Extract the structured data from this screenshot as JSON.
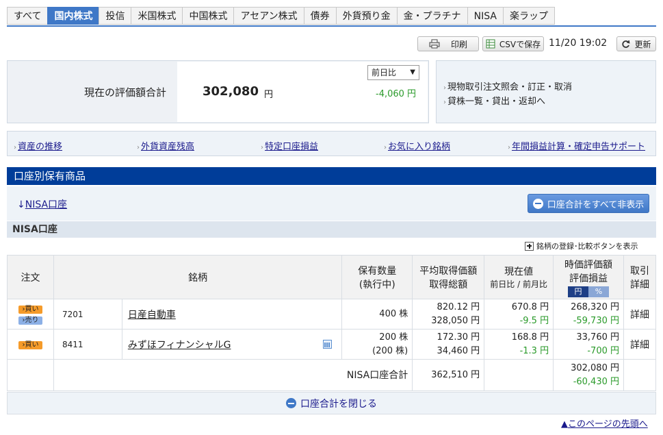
{
  "tabs": [
    {
      "label": "すべて",
      "active": false
    },
    {
      "label": "国内株式",
      "active": true
    },
    {
      "label": "投信",
      "active": false
    },
    {
      "label": "米国株式",
      "active": false
    },
    {
      "label": "中国株式",
      "active": false
    },
    {
      "label": "アセアン株式",
      "active": false
    },
    {
      "label": "債券",
      "active": false
    },
    {
      "label": "外貨預り金",
      "active": false
    },
    {
      "label": "金・プラチナ",
      "active": false
    },
    {
      "label": "NISA",
      "active": false
    },
    {
      "label": "楽ラップ",
      "active": false
    }
  ],
  "toolbar": {
    "print_label": "印刷",
    "csv_label": "CSVで保存",
    "timestamp": "11/20 19:02",
    "refresh_label": "更新"
  },
  "summary": {
    "label": "現在の評価額合計",
    "total_value": "302,080",
    "total_unit": "円",
    "compare_selected": "前日比",
    "diff_value": "-4,060 円"
  },
  "side_links": [
    "現物取引注文照会・訂正・取消",
    "貸株一覧・貸出・返却へ"
  ],
  "nav_links": [
    "資産の推移",
    "外貨資産残高",
    "特定口座損益",
    "お気に入り銘柄",
    "年間損益計算・確定申告サポート"
  ],
  "section": {
    "title": "口座別保有商品",
    "anchor_arrow": "↓",
    "anchor_label": "NISA口座",
    "hide_all_label": "口座合計をすべて非表示",
    "sub_title": "NISA口座",
    "show_compare_label": "銘柄の登録･比較ボタンを表示"
  },
  "table": {
    "headers": {
      "order": "注文",
      "name": "銘柄",
      "qty_1": "保有数量",
      "qty_2": "(執行中)",
      "avg_1": "平均取得価額",
      "avg_2": "取得総額",
      "price_1": "現在値",
      "price_2a": "前日比",
      "price_sep": " / ",
      "price_2b": "前月比",
      "val_1": "時価評価額",
      "val_2": "評価損益",
      "unit_yen": "円",
      "unit_pct": "%",
      "detail_1": "取引",
      "detail_2": "詳細"
    },
    "buy_label": "買い",
    "sell_label": "売り",
    "rows": [
      {
        "code": "7201",
        "name": "日産自動車",
        "qty": "400 株",
        "qty_pending": "",
        "avg_price": "820.12 円",
        "total_cost": "328,050 円",
        "price": "670.8 円",
        "change": "-9.5 円",
        "market_value": "268,320 円",
        "gain": "-59,730 円",
        "detail": "詳細"
      },
      {
        "code": "8411",
        "name": "みずほフィナンシャルG",
        "qty": "200 株",
        "qty_pending": "(200 株)",
        "avg_price": "172.30 円",
        "total_cost": "34,460 円",
        "price": "168.8 円",
        "change": "-1.3 円",
        "market_value": "33,760 円",
        "gain": "-700 円",
        "detail": "詳細"
      }
    ],
    "total": {
      "label": "NISA口座合計",
      "total_cost": "362,510 円",
      "market_value": "302,080 円",
      "gain": "-60,430 円"
    }
  },
  "close_label": "口座合計を閉じる",
  "page_top": {
    "arrow": "▲",
    "label": "このページの先頭へ"
  }
}
